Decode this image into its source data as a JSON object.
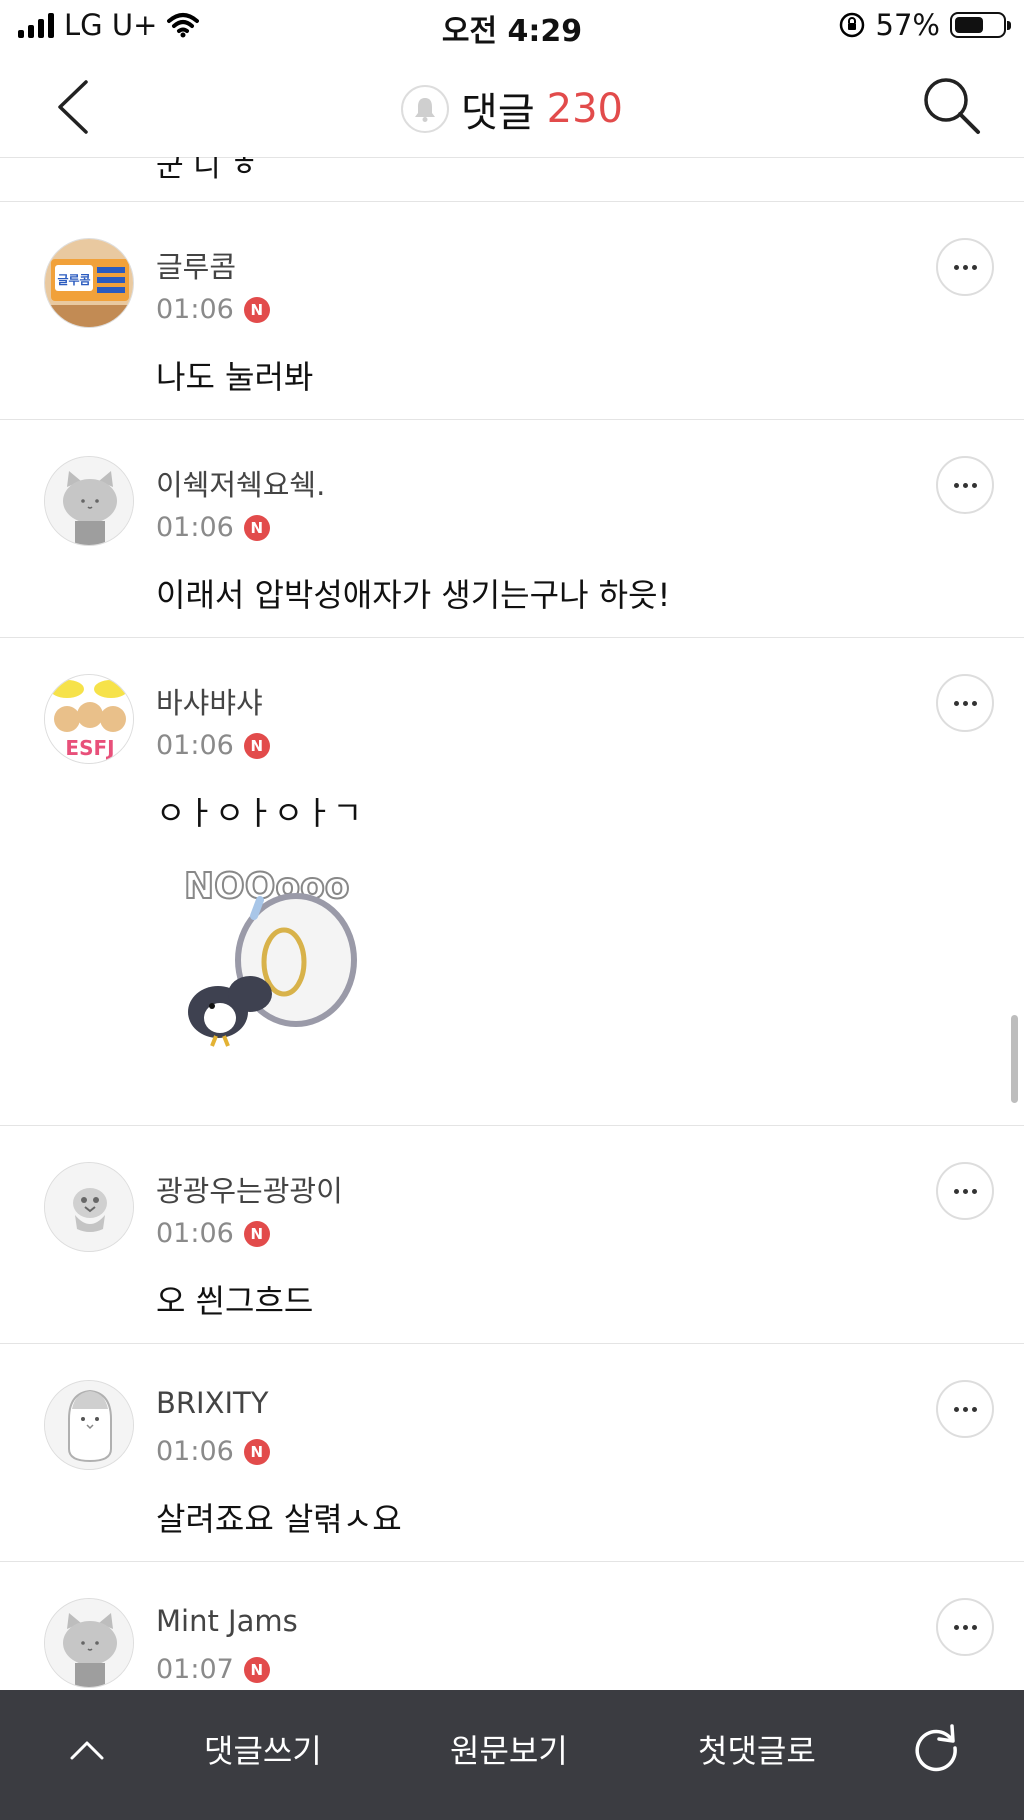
{
  "status_bar": {
    "carrier": "LG U+",
    "time": "오전 4:29",
    "battery": "57%"
  },
  "header": {
    "title": "댓글",
    "count": "230"
  },
  "partial_comment_text": "군 니 ㅎ",
  "comments": [
    {
      "name": "글루콤",
      "time": "01:06",
      "badge": "N",
      "text": "나도 눌러봐",
      "avatar": "glucom-product-avatar"
    },
    {
      "name": "이쉑저쉑요쉑.",
      "time": "01:06",
      "badge": "N",
      "text": "이래서 압박성애자가 생기는구나 하읏!",
      "avatar": "cat-default-avatar"
    },
    {
      "name": "바샤뱌샤",
      "time": "01:06",
      "badge": "N",
      "text": "ㅇㅏㅇㅏㅇㅏㄱ",
      "avatar": "esfj-bears-avatar",
      "sticker": {
        "text": "NOOooo",
        "name": "penguin-nooo-sticker"
      }
    },
    {
      "name": "광광우는광광이",
      "time": "01:06",
      "badge": "N",
      "text": "오 씐그흐드",
      "avatar": "bird-default-avatar"
    },
    {
      "name": "BRIXITY",
      "time": "01:06",
      "badge": "N",
      "text": "살려죠요 살렦ㅅ요",
      "avatar": "penguin-default-avatar"
    },
    {
      "name": "Mint Jams",
      "time": "01:07",
      "badge": "N",
      "text": "",
      "avatar": "cat-default-avatar"
    }
  ],
  "bottom_bar": {
    "write": "댓글쓰기",
    "original": "원문보기",
    "first": "첫댓글로"
  },
  "colors": {
    "accent": "#e24b4b",
    "bottom_bar": "#3b3c41"
  }
}
